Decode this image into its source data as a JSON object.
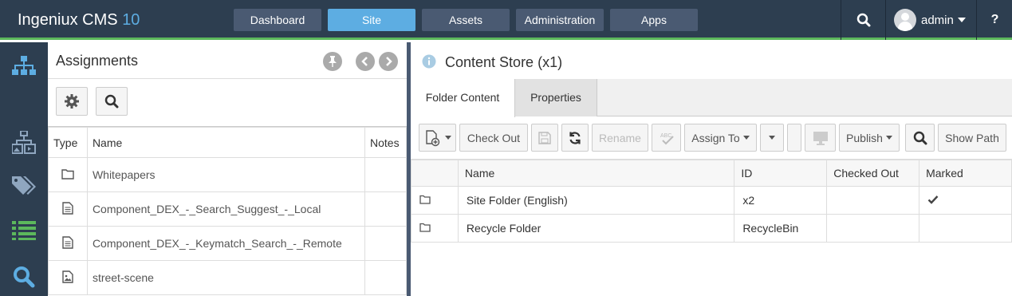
{
  "app": {
    "name": "Ingeniux CMS",
    "version": "10"
  },
  "topnav": {
    "items": [
      "Dashboard",
      "Site",
      "Assets",
      "Administration",
      "Apps"
    ],
    "active": "Site",
    "user": "admin",
    "help": "?"
  },
  "assignments": {
    "title": "Assignments",
    "columns": [
      "Type",
      "Name",
      "Notes"
    ],
    "rows": [
      {
        "type": "folder-icon",
        "name": "Whitepapers",
        "notes": ""
      },
      {
        "type": "document-icon",
        "name": "Component_DEX_-_Search_Suggest_-_Local",
        "notes": ""
      },
      {
        "type": "document-icon",
        "name": "Component_DEX_-_Keymatch_Search_-_Remote",
        "notes": ""
      },
      {
        "type": "image-icon",
        "name": "street-scene",
        "notes": ""
      }
    ]
  },
  "content_store": {
    "title": "Content Store (x1)",
    "tabs": [
      "Folder Content",
      "Properties"
    ],
    "active_tab": "Folder Content",
    "toolbar": {
      "check_out": "Check Out",
      "rename": "Rename",
      "assign_to": "Assign To",
      "publish": "Publish",
      "show_path": "Show Path"
    },
    "columns": [
      "Name",
      "ID",
      "Checked Out",
      "Marked"
    ],
    "rows": [
      {
        "name": "Site Folder (English)",
        "id": "x2",
        "checked_out": "",
        "marked": true
      },
      {
        "name": "Recycle Folder",
        "id": "RecycleBin",
        "checked_out": "",
        "marked": false
      }
    ]
  },
  "colors": {
    "header": "#2d3e50",
    "accent": "#5dade2",
    "green": "#5cb85c"
  }
}
